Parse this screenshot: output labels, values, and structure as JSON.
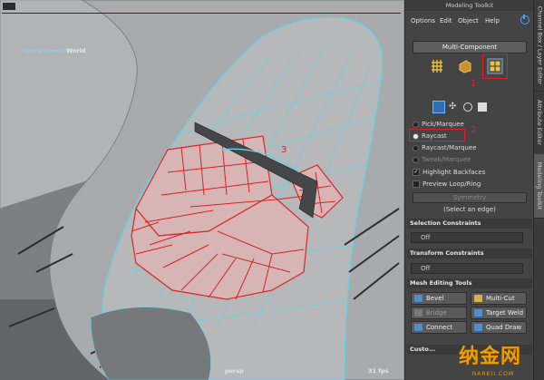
{
  "viewport": {
    "coord_space_label": "Coord Space:",
    "coord_space_value": "World",
    "camera_name": "persp",
    "fps": "31 fps",
    "annotation_3": "3"
  },
  "panel": {
    "title": "Modeling Toolkit",
    "menus": [
      "Options",
      "Edit",
      "Object",
      "Help"
    ],
    "multi_component_label": "Multi-Component",
    "annotation_1": "1",
    "annotation_2": "2",
    "selection_modes": [
      {
        "label": "Pick/Marquee",
        "selected": false,
        "enabled": true
      },
      {
        "label": "Raycast",
        "selected": true,
        "enabled": true
      },
      {
        "label": "Raycast/Marquee",
        "selected": false,
        "enabled": true
      },
      {
        "label": "Tweak/Marquee",
        "selected": false,
        "enabled": false
      }
    ],
    "checkboxes": [
      {
        "label": "Highlight Backfaces",
        "checked": true
      },
      {
        "label": "Preview Loop/Ring",
        "checked": false
      }
    ],
    "symmetry_label": "Symmetry",
    "select_hint": "(Select an edge)",
    "selection_constraints_label": "Selection Constraints",
    "selection_constraints_value": "Off",
    "transform_constraints_label": "Transform Constraints",
    "transform_constraints_value": "Off",
    "mesh_editing_label": "Mesh Editing Tools",
    "tools": [
      "Bevel",
      "Multi-Cut",
      "Bridge",
      "Target Weld",
      "Connect",
      "Quad Draw"
    ],
    "bottom_section_label": "Custo..."
  },
  "side_tabs": [
    "Channel Box / Layer Editor",
    "Attribute Editor",
    "Modeling Toolkit"
  ],
  "watermark": {
    "main": "纳金网",
    "sub": "NARKII.COM"
  },
  "colors": {
    "accent_red": "#e02020",
    "highlight_blue": "#4aa3ff"
  }
}
